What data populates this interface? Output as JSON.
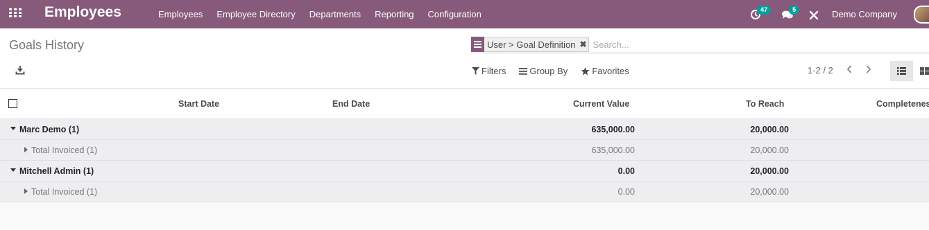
{
  "navbar": {
    "app_title": "Employees",
    "menu": [
      "Employees",
      "Employee Directory",
      "Departments",
      "Reporting",
      "Configuration"
    ],
    "activity_count": "47",
    "messages_count": "5",
    "company": "Demo Company",
    "brand_color": "#875a7b",
    "badge_color": "#00a09d"
  },
  "control_panel": {
    "breadcrumb": "Goals History",
    "search": {
      "facet_label": "User > Goal Definition",
      "placeholder": "Search..."
    },
    "filters_label": "Filters",
    "group_by_label": "Group By",
    "favorites_label": "Favorites",
    "pager_value": "1-2 / 2"
  },
  "table": {
    "headers": {
      "start_date": "Start Date",
      "end_date": "End Date",
      "current_value": "Current Value",
      "to_reach": "To Reach",
      "completeness": "Completeness"
    },
    "rows": [
      {
        "type": "group",
        "label": "Marc Demo (1)",
        "current_value": "635,000.00",
        "to_reach": "20,000.00"
      },
      {
        "type": "sub",
        "label": "Total Invoiced (1)",
        "current_value": "635,000.00",
        "to_reach": "20,000.00"
      },
      {
        "type": "group",
        "label": "Mitchell Admin (1)",
        "current_value": "0.00",
        "to_reach": "20,000.00"
      },
      {
        "type": "sub",
        "label": "Total Invoiced (1)",
        "current_value": "0.00",
        "to_reach": "20,000.00"
      }
    ]
  }
}
